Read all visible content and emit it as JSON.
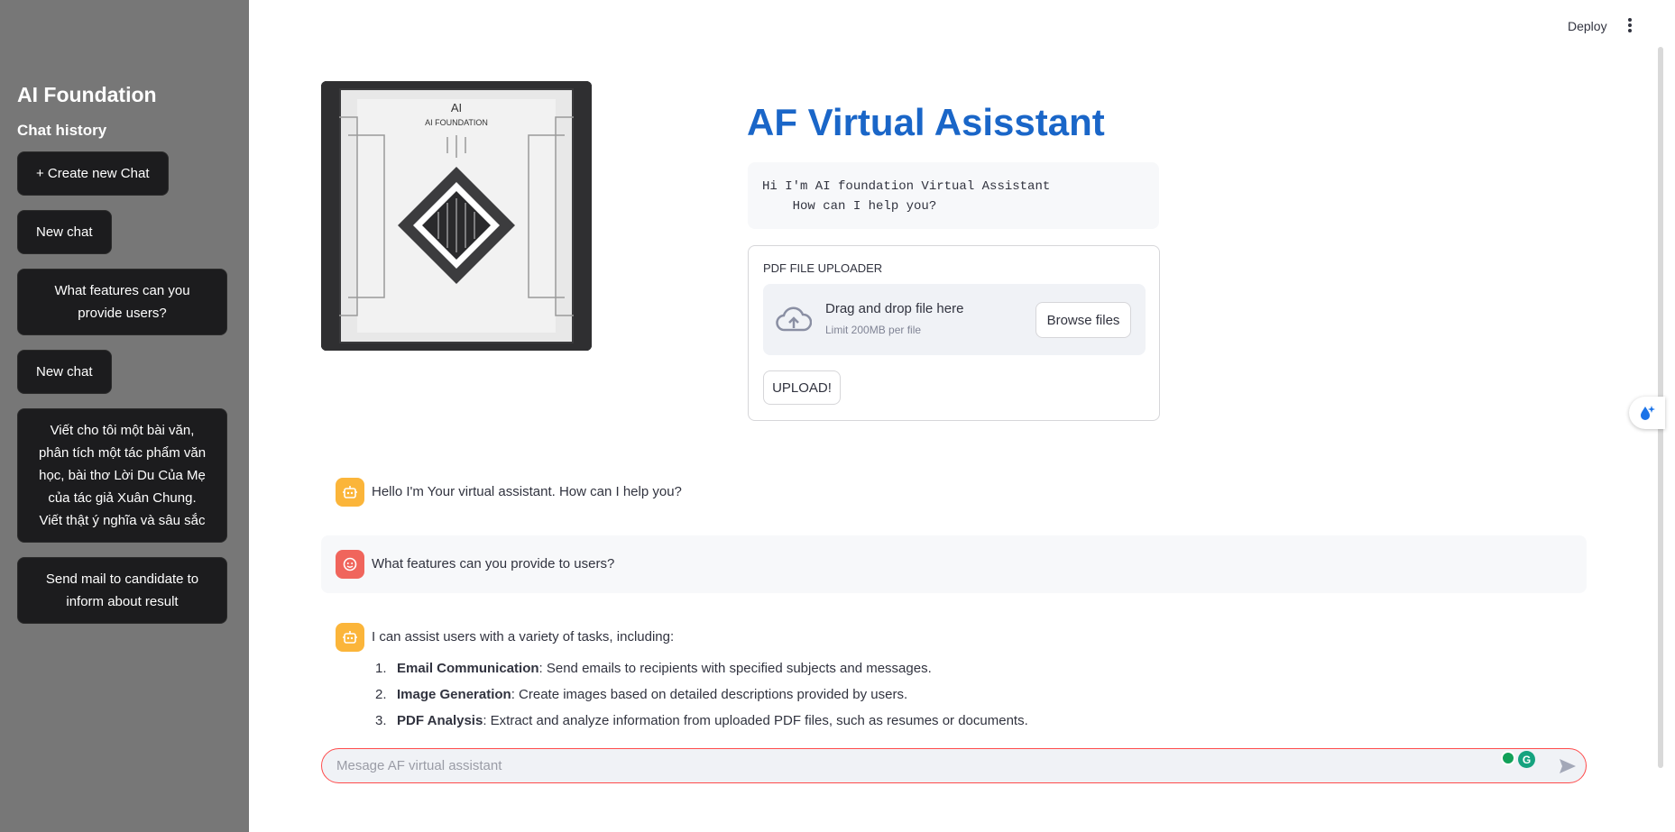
{
  "sidebar": {
    "title": "AI Foundation",
    "subtitle": "Chat history",
    "create_button": "+ Create new Chat",
    "items": [
      {
        "label": "New chat"
      },
      {
        "label": "What features can you provide users?"
      },
      {
        "label": "New chat"
      },
      {
        "label": "Viết cho tôi một bài văn, phân tích một tác phẩm văn học, bài thơ Lời Du Của Mẹ của tác giả Xuân Chung. Viết thật ý nghĩa và sâu sắc"
      },
      {
        "label": "Send mail to candidate to inform about result"
      }
    ]
  },
  "header": {
    "deploy_label": "Deploy",
    "menu_icon": "kebab-menu-icon"
  },
  "hero": {
    "image_text_logo": "AI",
    "image_text_name": "AI FOUNDATION"
  },
  "main": {
    "title": "AF Virtual Asisstant",
    "greeting": "Hi I'm AI foundation Virtual Assistant\n    How can I help you?"
  },
  "uploader": {
    "label": "PDF FILE UPLOADER",
    "drop_text": "Drag and drop file here",
    "limit_text": "Limit 200MB per file",
    "browse_label": "Browse files",
    "upload_label": "UPLOAD!"
  },
  "messages": [
    {
      "role": "assistant",
      "text": "Hello I'm Your virtual assistant. How can I help you?"
    },
    {
      "role": "user",
      "text": "What features can you provide to users?"
    },
    {
      "role": "assistant",
      "text": "I can assist users with a variety of tasks, including:"
    }
  ],
  "feature_list": [
    {
      "num": "1.",
      "title": "Email Communication",
      "desc": ": Send emails to recipients with specified subjects and messages."
    },
    {
      "num": "2.",
      "title": "Image Generation",
      "desc": ": Create images based on detailed descriptions provided by users."
    },
    {
      "num": "3.",
      "title": "PDF Analysis",
      "desc": ": Extract and analyze information from uploaded PDF files, such as resumes or documents."
    }
  ],
  "chat_input": {
    "placeholder": "Mesage AF virtual assistant"
  },
  "colors": {
    "sidebar_bg": "#777777",
    "title_blue": "#1a66c8",
    "bot_avatar": "#fbb53a",
    "user_avatar": "#f0655c",
    "input_border": "#ff4b4b"
  }
}
